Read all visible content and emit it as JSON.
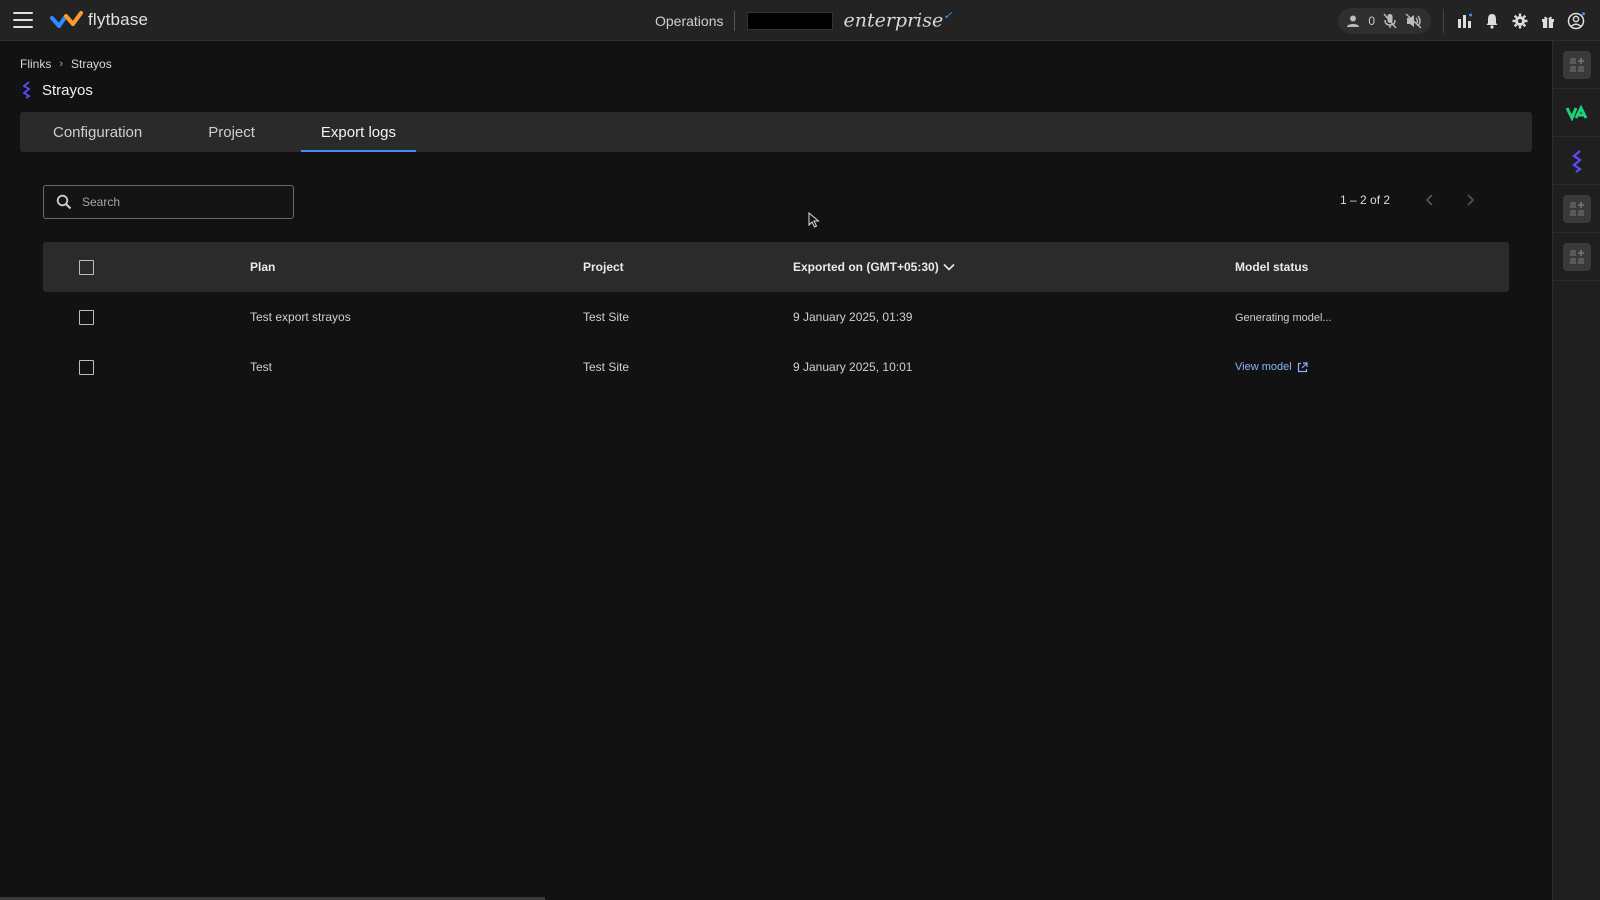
{
  "topbar": {
    "brand": "flytbase",
    "nav_label": "Operations",
    "edition": "enterprise",
    "users_online_count": "0"
  },
  "breadcrumb": {
    "root": "Flinks",
    "current": "Strayos"
  },
  "page": {
    "title": "Strayos"
  },
  "tabs": [
    {
      "label": "Configuration",
      "active": false
    },
    {
      "label": "Project",
      "active": false
    },
    {
      "label": "Export logs",
      "active": true
    }
  ],
  "search": {
    "placeholder": "Search",
    "value": ""
  },
  "pagination": {
    "range": "1 – 2 of 2"
  },
  "table": {
    "headers": {
      "plan": "Plan",
      "project": "Project",
      "exported": "Exported on (GMT+05:30)",
      "status": "Model status"
    },
    "rows": [
      {
        "plan": "Test export strayos",
        "project": "Test Site",
        "exported": "9 January 2025, 01:39",
        "status": "Generating model..."
      },
      {
        "plan": "Test",
        "project": "Test Site",
        "exported": "9 January 2025, 10:01",
        "status": "View model"
      }
    ]
  },
  "icons": {
    "accent": "#4a86ff",
    "link": "#8ab4ff",
    "rail_green": "#1ed27a",
    "rail_blue": "#5a4bff"
  }
}
